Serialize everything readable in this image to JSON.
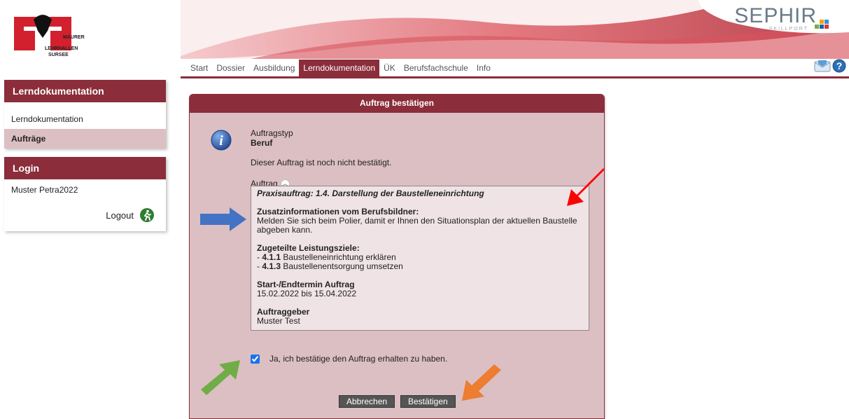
{
  "logo": {
    "line1": "MAURER",
    "line2": "LEHRHALLEN",
    "line3": "SURSEE"
  },
  "brand": {
    "name": "SEPHIR",
    "sub": "SKILLPORT",
    "accent": "#8b2d3a"
  },
  "topnav": [
    {
      "label": "Start"
    },
    {
      "label": "Dossier"
    },
    {
      "label": "Ausbildung"
    },
    {
      "label": "Lerndokumentation",
      "active": true
    },
    {
      "label": "ÜK"
    },
    {
      "label": "Berufsfachschule"
    },
    {
      "label": "Info"
    }
  ],
  "icons": {
    "mail": "mail-icon",
    "help": "help-icon"
  },
  "sidebar": {
    "section1_title": "Lerndokumentation",
    "items": [
      {
        "label": "Lerndokumentation"
      },
      {
        "label": "Aufträge",
        "active": true
      }
    ],
    "section2_title": "Login",
    "user": "Muster Petra2022",
    "logout": "Logout"
  },
  "panel": {
    "title": "Auftrag bestätigen",
    "type_label": "Auftragstyp",
    "type_value": "Beruf",
    "status_text": "Dieser Auftrag ist noch nicht bestätigt.",
    "auftrag_link": "Auftrag",
    "detail": {
      "heading": "Praxisauftrag: 1.4. Darstellung der Baustelleneinrichtung",
      "info_title": "Zusatzinformationen vom Berufsbildner:",
      "info_line1": "Melden Sie sich beim Polier, damit er Ihnen den Situationsplan der aktuellen Baustelle",
      "info_line2": "abgeben kann.",
      "goals_title": "Zugeteilte Leistungsziele:",
      "goal1_code": "4.1.1",
      "goal1_text": "Baustelleneinrichtung erklären",
      "goal2_code": "4.1.3",
      "goal2_text": "Baustellenentsorgung umsetzen",
      "dates_title": "Start-/Endtermin Auftrag",
      "dates_value": "15.02.2022 bis 15.04.2022",
      "client_title": "Auftraggeber",
      "client_value": "Muster Test"
    },
    "confirm_checkbox_label": "Ja, ich bestätige den Auftrag erhalten zu haben.",
    "confirm_checked": true,
    "cancel_button": "Abbrechen",
    "confirm_button": "Bestätigen"
  },
  "annotation_colors": {
    "red": "#ff0000",
    "blue": "#4472c4",
    "green": "#70ad47",
    "orange": "#ed7d31"
  }
}
